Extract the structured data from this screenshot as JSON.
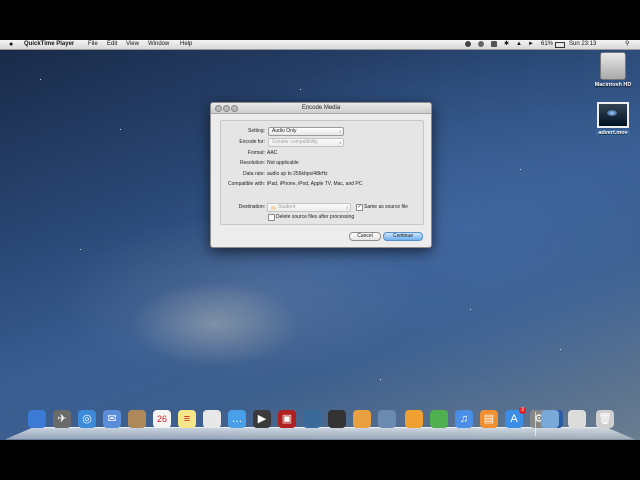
{
  "menubar": {
    "app_name": "QuickTime Player",
    "items": [
      "File",
      "Edit",
      "View",
      "Window",
      "Help"
    ],
    "battery": "61%",
    "clock": "Sun 23:13"
  },
  "desktop": {
    "icons": [
      {
        "label": "Macintosh HD",
        "icon": "hard-drive-icon"
      },
      {
        "label": "advert.mov",
        "icon": "movie-file-icon"
      }
    ]
  },
  "dialog": {
    "title": "Encode Media",
    "setting_label": "Setting:",
    "setting_value": "Audio Only",
    "encode_for_label": "Encode for:",
    "encode_for_value": "Greater compatibility",
    "format_label": "Format:",
    "format_value": "AAC",
    "resolution_label": "Resolution:",
    "resolution_value": "Not applicable",
    "data_rate_label": "Data rate:",
    "data_rate_value": "audio up to 256kbps/48kHz",
    "compatible_label": "Compatible with:",
    "compatible_value": "iPad, iPhone, iPod, Apple TV, Mac, and PC",
    "destination_label": "Destination:",
    "destination_value": "Student",
    "same_as_source_label": "Same as source file",
    "same_as_source_checked": true,
    "delete_source_label": "Delete source files after processing",
    "delete_source_checked": false,
    "cancel_label": "Cancel",
    "continue_label": "Continue"
  },
  "dock": {
    "items": [
      "finder-icon",
      "launchpad-icon",
      "safari-icon",
      "mail-icon",
      "contacts-icon",
      "calendar-icon",
      "notes-icon",
      "reminders-icon",
      "messages-icon",
      "facetime-icon",
      "photo-booth-icon",
      "iphoto-icon",
      "imovie-icon",
      "garageband-icon",
      "keynote-icon",
      "pages-icon",
      "numbers-icon",
      "itunes-icon",
      "ibooks-icon",
      "app-store-icon",
      "system-preferences-icon",
      "quicktime-icon",
      "downloads-folder-icon",
      "documents-stack-icon",
      "trash-icon"
    ],
    "calendar_date": "26",
    "app_store_badge": "3",
    "colors": [
      "#3b7bd6",
      "#6a6a6a",
      "#3c8ad8",
      "#5a8ed8",
      "#b0895a",
      "#f4f4f4",
      "#f5e68a",
      "#e8e8e8",
      "#4aa0e8",
      "#3a3a3a",
      "#b02020",
      "#3a6a9a",
      "#333333",
      "#e8a040",
      "#6a8ab0",
      "#f0a030",
      "#50b050",
      "#4a8ee8",
      "#f09030",
      "#3a8ee8",
      "#888888",
      "#2a5aa8",
      "#7aa8d8",
      "#dcdcdc",
      "#cfcfcf"
    ]
  }
}
